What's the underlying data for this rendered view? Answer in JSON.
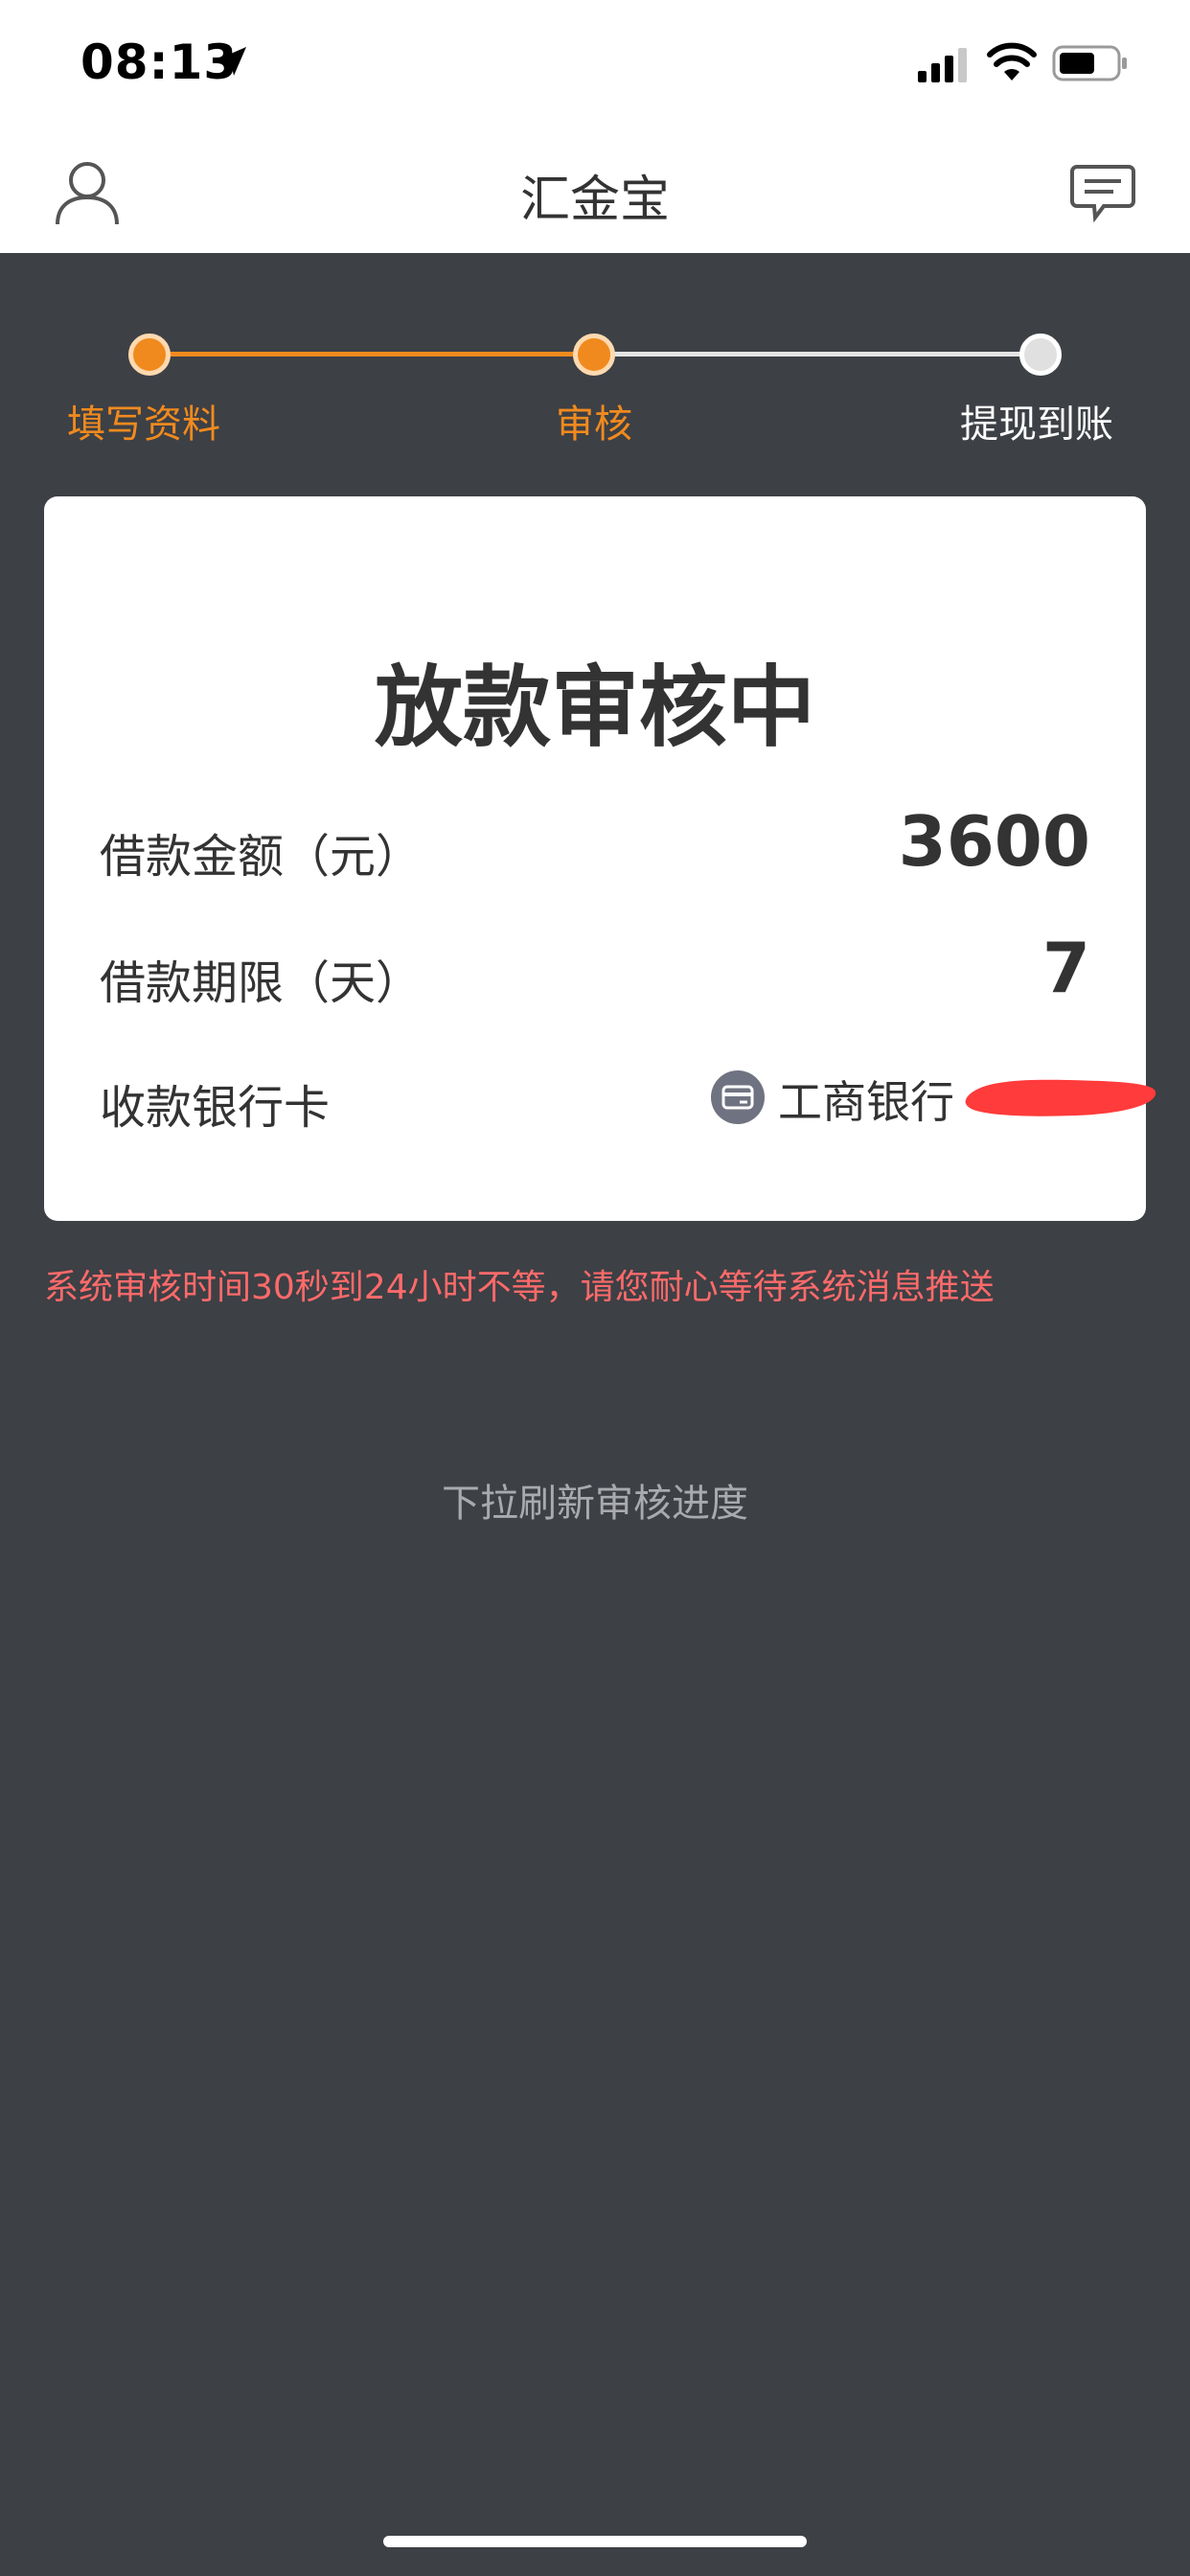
{
  "status_bar": {
    "time": "08:13",
    "icons": [
      "location-arrow-icon",
      "signal-icon",
      "wifi-icon",
      "battery-icon"
    ]
  },
  "nav": {
    "title": "汇金宝",
    "left_icon": "user-icon",
    "right_icon": "message-icon"
  },
  "steps": [
    {
      "label": "填写资料",
      "state": "done"
    },
    {
      "label": "审核",
      "state": "current"
    },
    {
      "label": "提现到账",
      "state": "pending"
    }
  ],
  "card": {
    "title": "放款审核中",
    "amount_label": "借款金额（元）",
    "amount_value": "3600",
    "term_label": "借款期限（天）",
    "term_value": "7",
    "bank_label": "收款银行卡",
    "bank_name": "工商银行"
  },
  "notice": "系统审核时间30秒到24小时不等，请您耐心等待系统消息推送",
  "pull_hint": "下拉刷新审核进度",
  "colors": {
    "accent": "#f08a1e",
    "background": "#3d4045",
    "notice": "#ff6a6a"
  }
}
